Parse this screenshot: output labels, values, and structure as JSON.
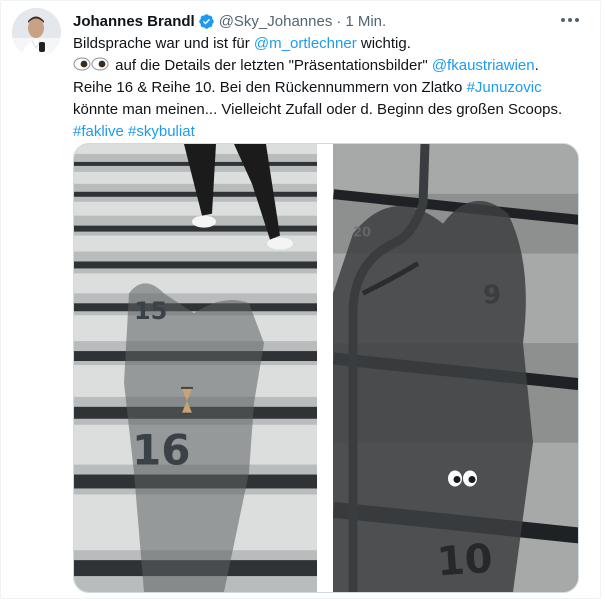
{
  "tweet": {
    "author_name": "Johannes Brandl",
    "author_handle": "@Sky_Johannes",
    "separator": "·",
    "timestamp": "1 Min.",
    "text": {
      "l1_pre": "Bildsprache war und ist für ",
      "l1_mention": "@m_ortlechner",
      "l1_post": " wichtig.",
      "l2_pre": " auf die Details der letzten \"Präsentationsbilder\" ",
      "l2_mention": "@fkaustriawien",
      "l2_post": ".",
      "l3": "Reihe 16 & Reihe 10. Bei den Rückennummern von Zlatko ",
      "l3_hashtag": "#Junuzovic",
      "l4": "könnte man meinen... Vielleicht Zufall oder d. Beginn des großen Scoops.",
      "hashtag1": "#faklive",
      "hashtag2": "#skybuliat"
    },
    "emoji": "eyes-emoji"
  },
  "media": {
    "left_photo": {
      "row_number_top": "15",
      "row_number_main": "16"
    },
    "right_photo": {
      "row_number_top": "9",
      "row_number_main": "10",
      "faint_number": "20"
    }
  },
  "icons": {
    "verified": "verified-badge-icon",
    "more": "more-horizontal-icon"
  },
  "colors": {
    "link": "#1d9bf0",
    "secondary_text": "#536471",
    "verified": "#1d9bf0"
  }
}
